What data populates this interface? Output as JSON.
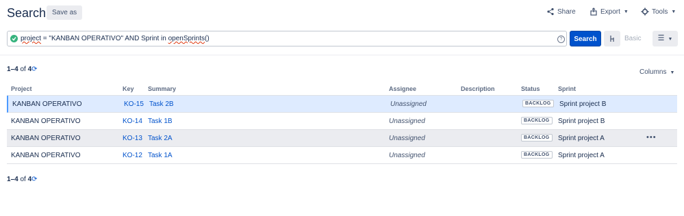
{
  "header": {
    "title": "Search",
    "save_as": "Save as",
    "share": "Share",
    "export": "Export",
    "tools": "Tools"
  },
  "search": {
    "query_parts": [
      "project",
      " = \"KANBAN OPERATIVO\" AND Sprint in ",
      "openSprints",
      "()"
    ],
    "search_label": "Search",
    "basic_label": "Basic",
    "help": "?"
  },
  "results": {
    "range": "1–4",
    "of": " of ",
    "total": "4",
    "columns_label": "Columns"
  },
  "table": {
    "headers": {
      "project": "Project",
      "key": "Key",
      "summary": "Summary",
      "assignee": "Assignee",
      "description": "Description",
      "status": "Status",
      "sprint": "Sprint"
    },
    "rows": [
      {
        "project": "KANBAN OPERATIVO",
        "key": "KO-15",
        "summary": "Task 2B",
        "assignee": "Unassigned",
        "description": "",
        "status": "BACKLOG",
        "sprint": "Sprint project B"
      },
      {
        "project": "KANBAN OPERATIVO",
        "key": "KO-14",
        "summary": "Task 1B",
        "assignee": "Unassigned",
        "description": "",
        "status": "BACKLOG",
        "sprint": "Sprint project B"
      },
      {
        "project": "KANBAN OPERATIVO",
        "key": "KO-13",
        "summary": "Task 2A",
        "assignee": "Unassigned",
        "description": "",
        "status": "BACKLOG",
        "sprint": "Sprint project A"
      },
      {
        "project": "KANBAN OPERATIVO",
        "key": "KO-12",
        "summary": "Task 1A",
        "assignee": "Unassigned",
        "description": "",
        "status": "BACKLOG",
        "sprint": "Sprint project A"
      }
    ],
    "row_menu": "•••"
  },
  "colors": {
    "primary": "#0052cc",
    "valid": "#36b37e",
    "selected_row": "#deebff",
    "hover_row": "#ebecf0"
  },
  "icons": [
    "check-circle-icon",
    "help-icon",
    "share-icon",
    "export-icon",
    "gear-icon",
    "switch-icon",
    "menu-icon",
    "refresh-icon",
    "chevron-down-icon",
    "more-icon"
  ]
}
